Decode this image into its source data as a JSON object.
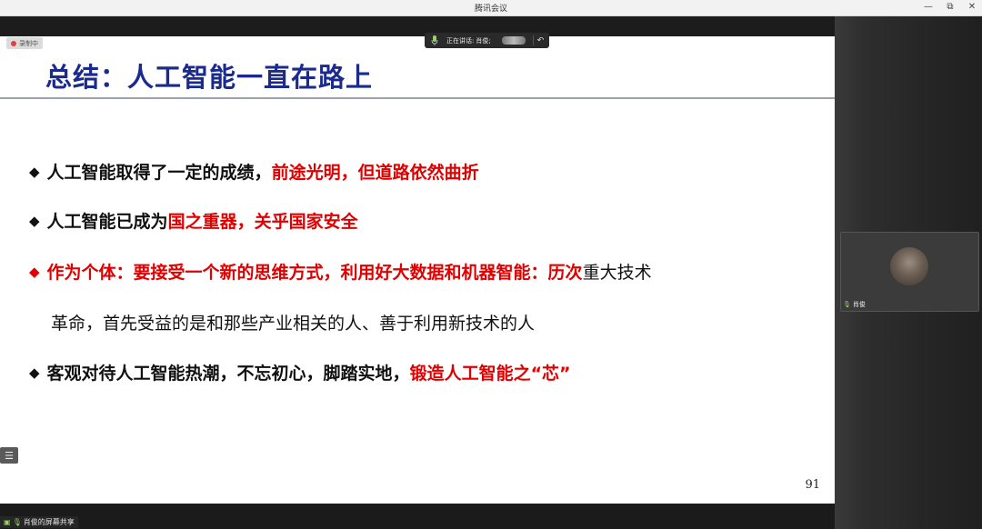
{
  "window": {
    "title": "腾讯会议",
    "controls": [
      "—",
      "⧉",
      "✕"
    ]
  },
  "recording_badge": "录制中",
  "speaking_bar": {
    "label": "正在讲话:",
    "name": "肖俊;"
  },
  "slide": {
    "title": "总结：人工智能一直在路上",
    "bullets": [
      {
        "parts": [
          {
            "text": "人工智能取得了一定的成绩，",
            "style": "black"
          },
          {
            "text": "前途光明，但道路依然曲折",
            "style": "red"
          }
        ]
      },
      {
        "parts": [
          {
            "text": "人工智能已成为",
            "style": "black"
          },
          {
            "text": "国之重器，",
            "style": "red"
          },
          {
            "text": "关乎国家安全",
            "style": "red"
          }
        ]
      },
      {
        "parts": [
          {
            "text": "作为个体：要接受一个新的思维方式，利用好大数据和机器智能：历次",
            "style": "red"
          },
          {
            "text": "重大技术",
            "style": "normal"
          }
        ],
        "continuation": "革命，首先受益的是和那些产业相关的人、善于利用新技术的人"
      },
      {
        "parts": [
          {
            "text": "客观对待人工智能热潮，不忘初心，脚踏实地，",
            "style": "black"
          },
          {
            "text": "锻造人工智能之“芯”",
            "style": "red"
          }
        ]
      }
    ],
    "page_number": "91"
  },
  "screen_share_label": "肖俊的屏幕共享",
  "participant": {
    "name": "肖俊"
  },
  "colors": {
    "title_blue": "#1b2a8f",
    "highlight_red": "#e00000"
  },
  "icons": {
    "bullet": "diamond",
    "menu": "list-icon",
    "mic": "microphone-icon"
  }
}
